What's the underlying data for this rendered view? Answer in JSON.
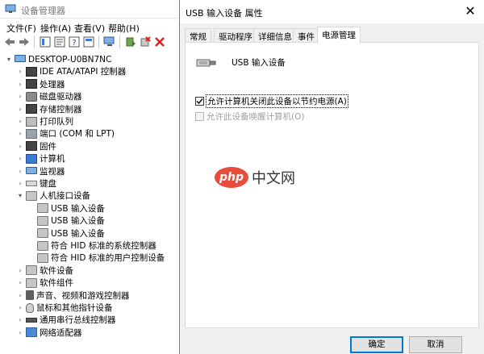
{
  "device_manager": {
    "title": "设备管理器",
    "menu": [
      "文件(F)",
      "操作(A)",
      "查看(V)",
      "帮助(H)"
    ],
    "tree": [
      {
        "label": "DESKTOP-U0BN7NC",
        "level": 0,
        "arrow": "▾",
        "icon": "monitor"
      },
      {
        "label": "IDE ATA/ATAPI 控制器",
        "level": 1,
        "arrow": "›",
        "icon": "chip"
      },
      {
        "label": "处理器",
        "level": 1,
        "arrow": "›",
        "icon": "chip"
      },
      {
        "label": "磁盘驱动器",
        "level": 1,
        "arrow": "›",
        "icon": "disk"
      },
      {
        "label": "存储控制器",
        "level": 1,
        "arrow": "›",
        "icon": "chip"
      },
      {
        "label": "打印队列",
        "level": 1,
        "arrow": "›",
        "icon": "printer"
      },
      {
        "label": "端口 (COM 和 LPT)",
        "level": 1,
        "arrow": "›",
        "icon": "grey"
      },
      {
        "label": "固件",
        "level": 1,
        "arrow": "›",
        "icon": "chip"
      },
      {
        "label": "计算机",
        "level": 1,
        "arrow": "›",
        "icon": "blue"
      },
      {
        "label": "监视器",
        "level": 1,
        "arrow": "›",
        "icon": "monitor"
      },
      {
        "label": "键盘",
        "level": 1,
        "arrow": "›",
        "icon": "keyboard"
      },
      {
        "label": "人机接口设备",
        "level": 1,
        "arrow": "▾",
        "icon": "hid"
      },
      {
        "label": "USB 输入设备",
        "level": 2,
        "arrow": "",
        "icon": "hid"
      },
      {
        "label": "USB 输入设备",
        "level": 2,
        "arrow": "",
        "icon": "hid"
      },
      {
        "label": "USB 输入设备",
        "level": 2,
        "arrow": "",
        "icon": "hid"
      },
      {
        "label": "符合 HID 标准的系统控制器",
        "level": 2,
        "arrow": "",
        "icon": "hid"
      },
      {
        "label": "符合 HID 标准的用户控制设备",
        "level": 2,
        "arrow": "",
        "icon": "hid"
      },
      {
        "label": "软件设备",
        "level": 1,
        "arrow": "›",
        "icon": "hid"
      },
      {
        "label": "软件组件",
        "level": 1,
        "arrow": "›",
        "icon": "hid"
      },
      {
        "label": "声音、视频和游戏控制器",
        "level": 1,
        "arrow": "›",
        "icon": "sound"
      },
      {
        "label": "鼠标和其他指针设备",
        "level": 1,
        "arrow": "›",
        "icon": "mouse"
      },
      {
        "label": "通用串行总线控制器",
        "level": 1,
        "arrow": "›",
        "icon": "usb"
      },
      {
        "label": "网络适配器",
        "level": 1,
        "arrow": "›",
        "icon": "net"
      }
    ]
  },
  "dialog": {
    "title": "USB 输入设备 属性",
    "close_glyph": "✕",
    "tabs": [
      "常规",
      "驱动程序",
      "详细信息",
      "事件",
      "电源管理"
    ],
    "active_tab": "电源管理",
    "device_name": "USB 输入设备",
    "options": [
      {
        "label": "允许计算机关闭此设备以节约电源(A)",
        "checked": true,
        "enabled": true
      },
      {
        "label": "允许此设备唤醒计算机(O)",
        "checked": false,
        "enabled": false
      }
    ],
    "watermark_logo": "php",
    "watermark_text": "中文网",
    "ok_label": "确定",
    "cancel_label": "取消"
  }
}
